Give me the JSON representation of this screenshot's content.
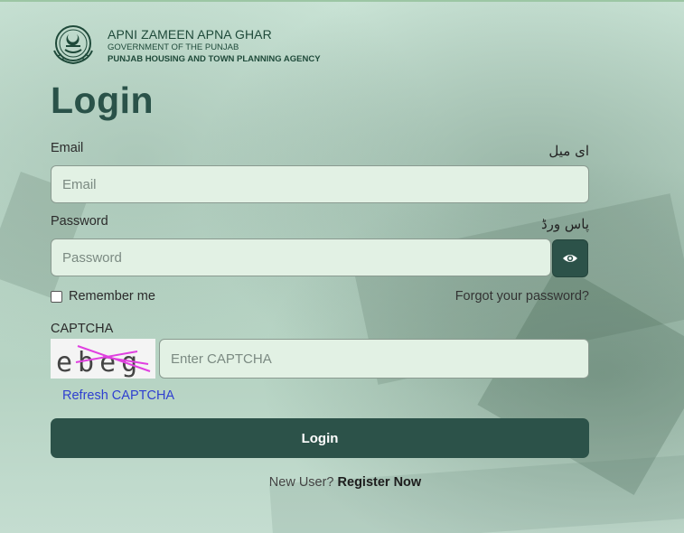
{
  "brand": {
    "line1": "APNI ZAMEEN APNA GHAR",
    "line2": "GOVERNMENT OF THE PUNJAB",
    "line3": "PUNJAB HOUSING AND TOWN PLANNING AGENCY",
    "logo_icon": "punjab-emblem-icon"
  },
  "title": "Login",
  "email": {
    "label": "Email",
    "urdu_label": "ای میل",
    "placeholder": "Email",
    "value": ""
  },
  "password": {
    "label": "Password",
    "urdu_label": "پاس ورڈ",
    "placeholder": "Password",
    "value": "",
    "toggle_icon": "eye-icon"
  },
  "remember": {
    "label": "Remember me",
    "checked": false
  },
  "forgot_label": "Forgot your password?",
  "captcha": {
    "label": "CAPTCHA",
    "image_text": "ebeg",
    "placeholder": "Enter CAPTCHA",
    "value": "",
    "refresh_label": "Refresh CAPTCHA"
  },
  "login_button": "Login",
  "register": {
    "prompt": "New User?",
    "link": "Register Now"
  },
  "colors": {
    "primary": "#2c5249",
    "input_bg": "#e2f1e4",
    "link": "#2f3fd0",
    "captcha_strike": "#e040e0"
  }
}
